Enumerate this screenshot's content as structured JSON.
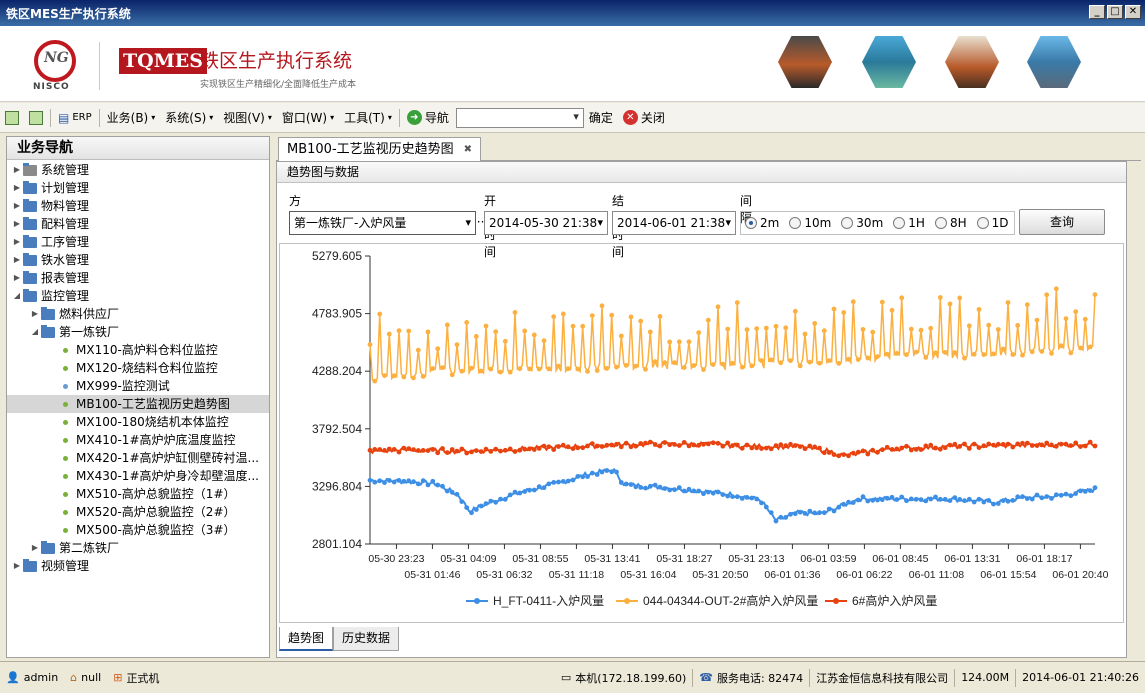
{
  "window": {
    "title": "铁区MES生产执行系统"
  },
  "banner": {
    "logo_text": "NISCO",
    "brand": "TQMES",
    "title": "铁区生产执行系统",
    "subtitle": "实现铁区生产精细化/全面降低生产成本"
  },
  "toolbar": {
    "erp": "ERP",
    "menus": [
      "业务(B)",
      "系统(S)",
      "视图(V)",
      "窗口(W)",
      "工具(T)"
    ],
    "nav_label": "导航",
    "confirm": "确定",
    "close": "关闭"
  },
  "nav": {
    "title": "业务导航",
    "items": [
      {
        "label": "系统管理"
      },
      {
        "label": "计划管理"
      },
      {
        "label": "物料管理"
      },
      {
        "label": "配料管理"
      },
      {
        "label": "工序管理"
      },
      {
        "label": "铁水管理"
      },
      {
        "label": "报表管理"
      },
      {
        "label": "监控管理"
      },
      {
        "label": "燃料供应厂"
      },
      {
        "label": "第一炼铁厂"
      },
      {
        "label": "MX110-高炉料仓料位监控"
      },
      {
        "label": "MX120-烧结料仓料位监控"
      },
      {
        "label": "MX999-监控测试"
      },
      {
        "label": "MB100-工艺监视历史趋势图"
      },
      {
        "label": "MX100-180烧结机本体监控"
      },
      {
        "label": "MX410-1#高炉炉底温度监控"
      },
      {
        "label": "MX420-1#高炉炉缸侧壁砖衬温..."
      },
      {
        "label": "MX430-1#高炉炉身冷却壁温度..."
      },
      {
        "label": "MX510-高炉总貌监控（1#）"
      },
      {
        "label": "MX520-高炉总貌监控（2#）"
      },
      {
        "label": "MX500-高炉总貌监控（3#）"
      },
      {
        "label": "第二炼铁厂"
      },
      {
        "label": "视频管理"
      }
    ]
  },
  "main": {
    "tab_title": "MB100-工艺监视历史趋势图",
    "tab_close": "✖",
    "panel_title": "趋势图与数据",
    "filters": {
      "scheme_label": "方案",
      "scheme_value": "第一炼铁厂-入炉风量",
      "scheme_more": "···",
      "start_label": "开始时间",
      "start_value": "2014-05-30 21:38",
      "end_label": "结束时间",
      "end_value": "2014-06-01 21:38",
      "interval_label": "间隔",
      "intervals": [
        "2m",
        "10m",
        "30m",
        "1H",
        "8H",
        "1D"
      ],
      "query": "查询"
    },
    "bottom_tabs": [
      "趋势图",
      "历史数据"
    ]
  },
  "status": {
    "user": "admin",
    "home": "null",
    "mode": "正式机",
    "host": "本机(172.18.199.60)",
    "service": "服务电话: 82474",
    "company": "江苏金恒信息科技有限公司",
    "memory": "124.00M",
    "datetime": "2014-06-01 21:40:26"
  },
  "colors": {
    "series_blue": "#3d8fe6",
    "series_orange": "#fbb040",
    "series_red": "#e8430f",
    "brand_red": "#b5171e"
  },
  "chart_data": {
    "type": "line",
    "title": "",
    "xlabel": "",
    "ylabel": "",
    "ylim": [
      2801.104,
      5279.605
    ],
    "yticks": [
      "5279.605",
      "4783.905",
      "4288.204",
      "3792.504",
      "3296.804",
      "2801.104"
    ],
    "xticks_top": [
      "05-30 23:23",
      "05-31 04:09",
      "05-31 08:55",
      "05-31 13:41",
      "05-31 18:27",
      "05-31 23:13",
      "06-01 03:59",
      "06-01 08:45",
      "06-01 13:31",
      "06-01 18:17"
    ],
    "xticks_bottom": [
      "05-31 01:46",
      "05-31 06:32",
      "05-31 11:18",
      "05-31 16:04",
      "05-31 20:50",
      "06-01 01:36",
      "06-01 06:22",
      "06-01 11:08",
      "06-01 15:54",
      "06-01 20:40"
    ],
    "x_range": [
      "2014-05-30 21:38",
      "2014-06-01 21:38"
    ],
    "series": [
      {
        "name": "H_FT-0411-入炉风量",
        "color": "#3d8fe6",
        "x": [
          "05-30 21:38",
          "05-31 00:00",
          "05-31 02:00",
          "05-31 03:30",
          "05-31 04:15",
          "05-31 05:00",
          "05-31 06:30",
          "05-31 08:00",
          "05-31 10:00",
          "05-31 12:00",
          "05-31 13:45",
          "05-31 14:30",
          "05-31 17:00",
          "05-31 20:00",
          "05-31 22:00",
          "05-31 23:30",
          "06-01 00:30",
          "06-01 02:00",
          "06-01 03:30",
          "06-01 04:30",
          "06-01 06:00",
          "06-01 09:00",
          "06-01 12:00",
          "06-01 15:00",
          "06-01 17:00",
          "06-01 19:00",
          "06-01 21:38"
        ],
        "values": [
          3350,
          3340,
          3320,
          3220,
          3080,
          3130,
          3200,
          3260,
          3320,
          3400,
          3440,
          3310,
          3290,
          3250,
          3220,
          3180,
          3000,
          3070,
          3060,
          3110,
          3190,
          3190,
          3190,
          3160,
          3200,
          3210,
          3270
        ]
      },
      {
        "name": "044-04344-OUT-2#高炉入炉风量",
        "color": "#fbb040",
        "x": [
          "05-30 21:38",
          "05-31 00:00",
          "05-31 04:00",
          "05-31 08:00",
          "05-31 12:00",
          "05-31 16:00",
          "05-31 20:00",
          "06-01 00:00",
          "06-01 04:00",
          "06-01 08:00",
          "06-01 12:00",
          "06-01 16:00",
          "06-01 21:38"
        ],
        "values": [
          4230,
          4260,
          4300,
          4310,
          4320,
          4340,
          4330,
          4350,
          4380,
          4410,
          4430,
          4450,
          4490
        ]
      },
      {
        "name": "6#高炉入炉风量",
        "color": "#e8430f",
        "x": [
          "05-30 21:38",
          "05-31 00:00",
          "05-31 04:00",
          "05-31 08:00",
          "05-31 13:00",
          "05-31 16:00",
          "05-31 20:00",
          "05-31 23:00",
          "06-01 02:00",
          "06-01 04:00",
          "06-01 05:00",
          "06-01 08:00",
          "06-01 12:00",
          "06-01 16:00",
          "06-01 21:38"
        ],
        "values": [
          3600,
          3610,
          3600,
          3620,
          3650,
          3660,
          3660,
          3640,
          3640,
          3600,
          3560,
          3620,
          3640,
          3650,
          3660
        ]
      }
    ],
    "legend_placement": "bottom",
    "grid": false
  }
}
